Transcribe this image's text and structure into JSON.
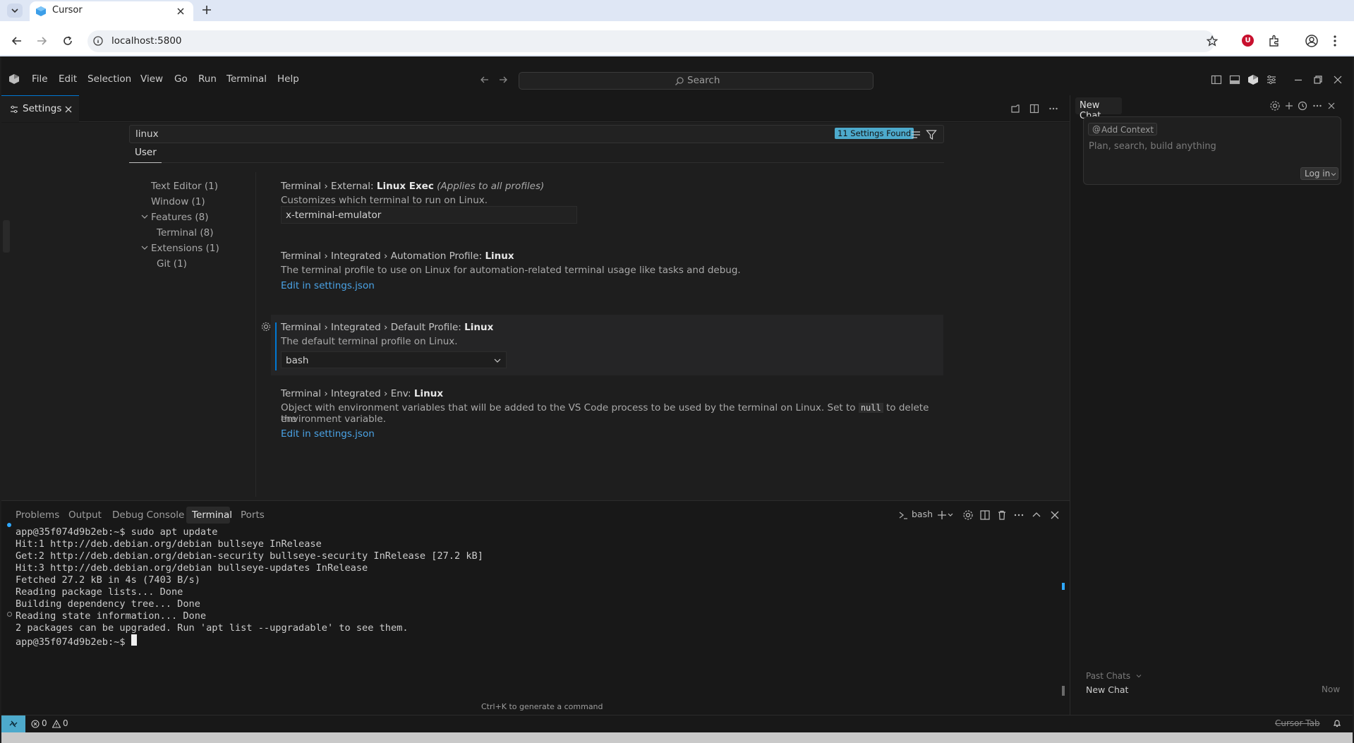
{
  "browser": {
    "tab_title": "Cursor",
    "url": "localhost:5800",
    "ext_badge": "U"
  },
  "menu": [
    "File",
    "Edit",
    "Selection",
    "View",
    "Go",
    "Run",
    "Terminal",
    "Help"
  ],
  "title_search_placeholder": "Search",
  "editor_tab": "Settings",
  "settings": {
    "query": "linux",
    "found": "11 Settings Found",
    "scope_tab": "User",
    "toc": [
      "Text Editor (1)",
      "Window (1)",
      "Features (8)",
      "Terminal (8)",
      "Extensions (1)",
      "Git (1)"
    ],
    "items": [
      {
        "prefix": "Terminal › External: ",
        "key": "Linux Exec",
        "note": "(Applies to all profiles)",
        "desc": "Customizes which terminal to run on Linux.",
        "value": "x-terminal-emulator"
      },
      {
        "prefix": "Terminal › Integrated › Automation Profile: ",
        "key": "Linux",
        "desc": "The terminal profile to use on Linux for automation-related terminal usage like tasks and debug.",
        "link": "Edit in settings.json"
      },
      {
        "prefix": "Terminal › Integrated › Default Profile: ",
        "key": "Linux",
        "desc": "The default terminal profile on Linux.",
        "value": "bash"
      },
      {
        "prefix": "Terminal › Integrated › Env: ",
        "key": "Linux",
        "desc_a": "Object with environment variables that will be added to the VS Code process to be used by the terminal on Linux. Set to ",
        "code": "null",
        "desc_b": " to delete the",
        "desc_c": "environment variable.",
        "link": "Edit in settings.json"
      }
    ]
  },
  "panel": {
    "tabs": [
      "Problems",
      "Output",
      "Debug Console",
      "Terminal",
      "Ports"
    ],
    "shell": "bash",
    "lines": [
      "app@35f074d9b2eb:~$ sudo apt update",
      "Hit:1 http://deb.debian.org/debian bullseye InRelease",
      "Get:2 http://deb.debian.org/debian-security bullseye-security InRelease [27.2 kB]",
      "Hit:3 http://deb.debian.org/debian bullseye-updates InRelease",
      "Fetched 27.2 kB in 4s (7403 B/s)",
      "Reading package lists... Done",
      "Building dependency tree... Done",
      "Reading state information... Done",
      "2 packages can be upgraded. Run 'apt list --upgradable' to see them.",
      "app@35f074d9b2eb:~$ "
    ],
    "hint": "Ctrl+K to generate a command"
  },
  "chat": {
    "title": "New Chat",
    "add_context": "Add Context",
    "placeholder": "Plan, search, build anything",
    "login": "Log in",
    "past_chats": "Past Chats",
    "history_item": "New Chat",
    "history_time": "Now"
  },
  "status": {
    "errors": "0",
    "warnings": "0",
    "cursor_tab": "Cursor Tab"
  },
  "colors": {
    "accent": "#0078d4",
    "badge_bg": "#4daacc",
    "link": "#4aa3e6",
    "ext_red": "#c8102e"
  }
}
